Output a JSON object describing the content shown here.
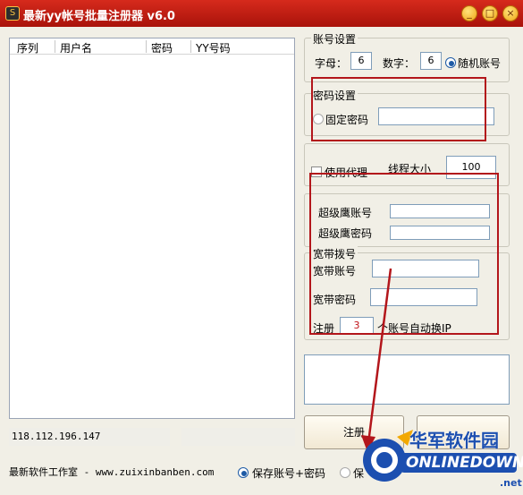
{
  "window": {
    "title": "最新yy帐号批量注册器 v6.0",
    "min_label": "_",
    "max_label": "□",
    "close_label": "×",
    "app_icon_glyph": "S"
  },
  "list": {
    "columns": [
      "序列",
      "用户名",
      "密码",
      "YY号码"
    ]
  },
  "status": {
    "ip": "118.112.196.147"
  },
  "footer": {
    "studio": "最新软件工作室 - www.zuixinbanben.com",
    "save_option_1": "保存账号+密码",
    "save_option_2": "保"
  },
  "account": {
    "group_title": "账号设置",
    "letters_label": "字母：",
    "letters_value": "6",
    "digits_label": "数字：",
    "digits_value": "6",
    "random_label": "随机账号"
  },
  "password": {
    "group_title": "密码设置",
    "fixed_label": "固定密码",
    "fixed_value": ""
  },
  "proxy": {
    "use_proxy_label": "使用代理",
    "threads_label": "线程大小",
    "threads_value": "100"
  },
  "super": {
    "account_label": "超级鹰账号",
    "password_label": "超级鹰密码"
  },
  "broadband": {
    "group_title": "宽带拨号",
    "account_label": "宽带账号",
    "password_label": "宽带密码",
    "register_label": "注册",
    "register_count": "3",
    "auto_ip_label": "个账号自动换IP"
  },
  "buttons": {
    "register": "注册"
  },
  "watermark": {
    "text_cn": "华军软件园",
    "text_en": "ONLINEDOWN",
    "suffix": ".net"
  },
  "colors": {
    "title_bar": "#c01d12",
    "annotation_red": "#b3161b",
    "accent_blue": "#1d5aa5"
  },
  "icons": {
    "window_controls": [
      "minimize-icon",
      "maximize-icon",
      "close-icon"
    ]
  }
}
